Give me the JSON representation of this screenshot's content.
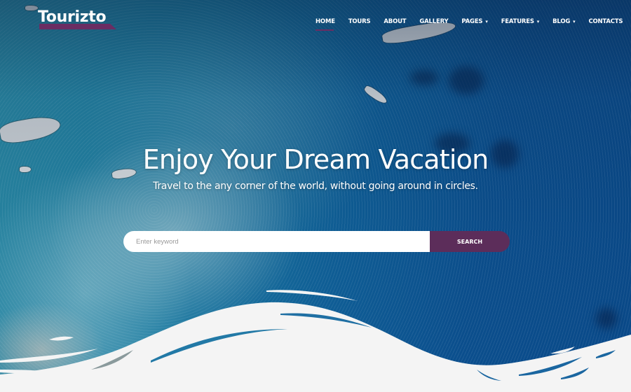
{
  "brand": {
    "name": "Tourizto",
    "accent_color": "#6a2d63"
  },
  "nav": {
    "items": [
      {
        "label": "HOME",
        "active": true,
        "has_dropdown": false
      },
      {
        "label": "TOURS",
        "active": false,
        "has_dropdown": false
      },
      {
        "label": "ABOUT",
        "active": false,
        "has_dropdown": false
      },
      {
        "label": "GALLERY",
        "active": false,
        "has_dropdown": false
      },
      {
        "label": "PAGES",
        "active": false,
        "has_dropdown": true
      },
      {
        "label": "FEATURES",
        "active": false,
        "has_dropdown": true
      },
      {
        "label": "BLOG",
        "active": false,
        "has_dropdown": true
      },
      {
        "label": "CONTACTS",
        "active": false,
        "has_dropdown": false
      }
    ],
    "dropdown_icon": "chevron-down-icon",
    "dropdown_glyph": "▾"
  },
  "hero": {
    "title": "Enjoy Your Dream Vacation",
    "subtitle": "Travel to the any corner of the world, without going around in circles."
  },
  "search": {
    "value": "",
    "placeholder": "Enter keyword",
    "button_label": "SEARCH",
    "button_color": "#5c2d5a"
  }
}
